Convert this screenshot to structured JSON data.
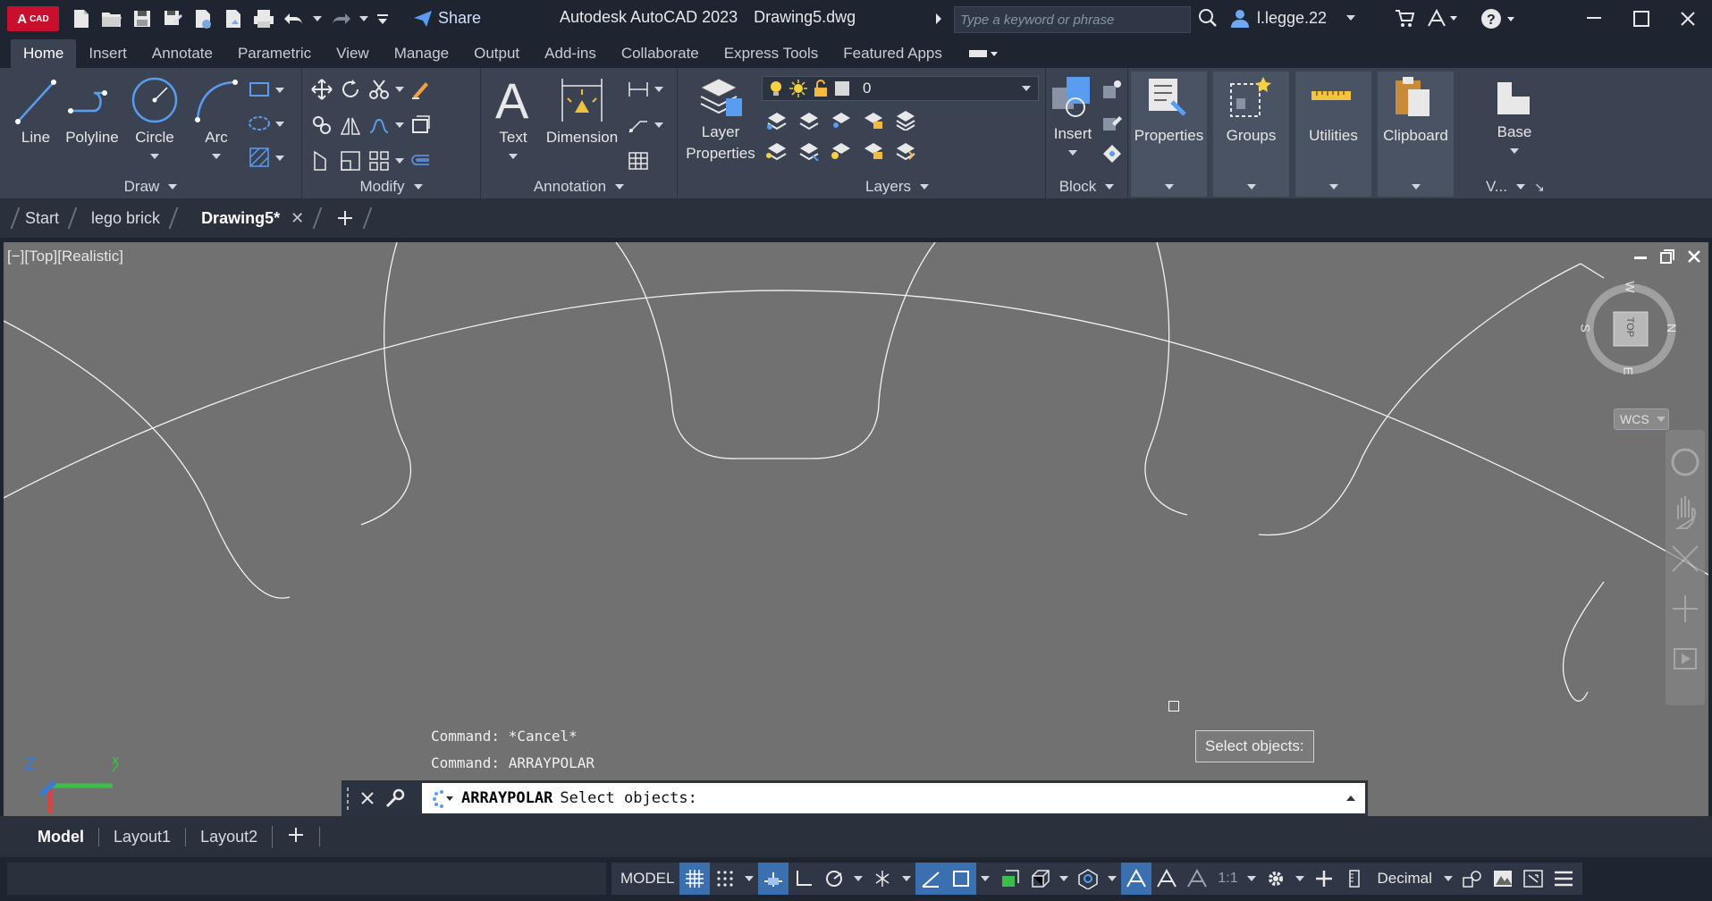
{
  "app": {
    "logo_main": "A",
    "logo_sub": "CAD",
    "title": "Autodesk AutoCAD 2023",
    "document": "Drawing5.dwg",
    "share_label": "Share",
    "search_placeholder": "Type a keyword or phrase",
    "user": "l.legge.22"
  },
  "ribbon_tabs": [
    {
      "label": "Home"
    },
    {
      "label": "Insert"
    },
    {
      "label": "Annotate"
    },
    {
      "label": "Parametric"
    },
    {
      "label": "View"
    },
    {
      "label": "Manage"
    },
    {
      "label": "Output"
    },
    {
      "label": "Add-ins"
    },
    {
      "label": "Collaborate"
    },
    {
      "label": "Express Tools"
    },
    {
      "label": "Featured Apps"
    }
  ],
  "ribbon": {
    "draw": {
      "title": "Draw",
      "line": "Line",
      "polyline": "Polyline",
      "circle": "Circle",
      "arc": "Arc"
    },
    "modify": {
      "title": "Modify"
    },
    "annotation": {
      "title": "Annotation",
      "text": "Text",
      "dimension": "Dimension"
    },
    "layers": {
      "title": "Layers",
      "layer_props_1": "Layer",
      "layer_props_2": "Properties",
      "current_layer": "0"
    },
    "block": {
      "title": "Block",
      "insert": "Insert"
    },
    "properties": "Properties",
    "groups": "Groups",
    "utilities": "Utilities",
    "clipboard": "Clipboard",
    "base": "Base",
    "view_short": "V..."
  },
  "file_tabs": [
    {
      "label": "Start"
    },
    {
      "label": "lego brick"
    },
    {
      "label": "Drawing5*",
      "active": true
    }
  ],
  "viewport": {
    "label": "[−][Top][Realistic]",
    "viewcube": {
      "top": "TOP",
      "n": "N",
      "s": "S",
      "e": "E",
      "w": "W"
    },
    "wcs": "WCS",
    "tooltip": "Select objects:",
    "history": [
      "Command: *Cancel*",
      "Command: ARRAYPOLAR"
    ]
  },
  "command": {
    "name": "ARRAYPOLAR",
    "prompt": "Select objects:"
  },
  "layout_tabs": [
    {
      "label": "Model",
      "active": true
    },
    {
      "label": "Layout1"
    },
    {
      "label": "Layout2"
    }
  ],
  "status": {
    "model": "MODEL",
    "scale": "1:1",
    "units": "Decimal"
  },
  "colors": {
    "accent": "#3a6fb0",
    "viewport_bg": "#717171",
    "ribbon_bg": "#3b4352",
    "titlebar_bg": "#1e2430"
  }
}
